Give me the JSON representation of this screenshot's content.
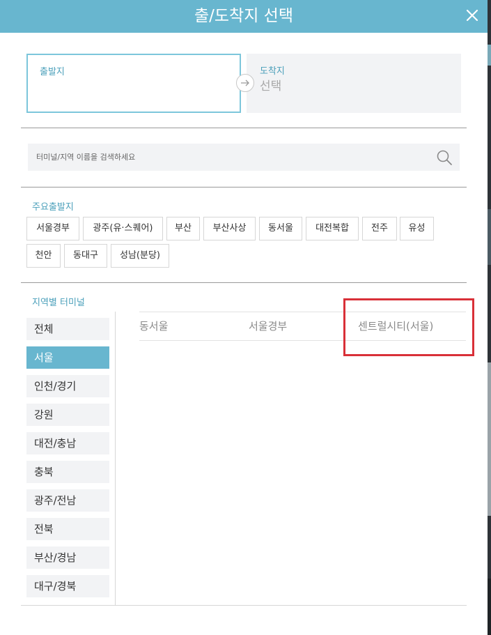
{
  "header": {
    "title": "출/도착지 선택",
    "close_icon": "close-icon"
  },
  "departure": {
    "label": "출발지",
    "value": ""
  },
  "arrival": {
    "label": "도착지",
    "value": "선택"
  },
  "search": {
    "placeholder": "터미널/지역 이름을 검색하세요",
    "value": ""
  },
  "major": {
    "title": "주요출발지",
    "chips": [
      "서울경부",
      "광주(유·스퀘어)",
      "부산",
      "부산사상",
      "동서울",
      "대전복합",
      "전주",
      "유성",
      "천안",
      "동대구",
      "성남(분당)"
    ]
  },
  "regional": {
    "title": "지역별 터미널",
    "regions": [
      "전체",
      "서울",
      "인천/경기",
      "강원",
      "대전/충남",
      "충북",
      "광주/전남",
      "전북",
      "부산/경남",
      "대구/경북"
    ],
    "selected_region": "서울",
    "terminals": [
      "동서울",
      "서울경부",
      "센트럴시티(서울)"
    ]
  },
  "colors": {
    "accent": "#68b6cf",
    "highlight": "#d93038",
    "panel": "#f2f3f5"
  }
}
